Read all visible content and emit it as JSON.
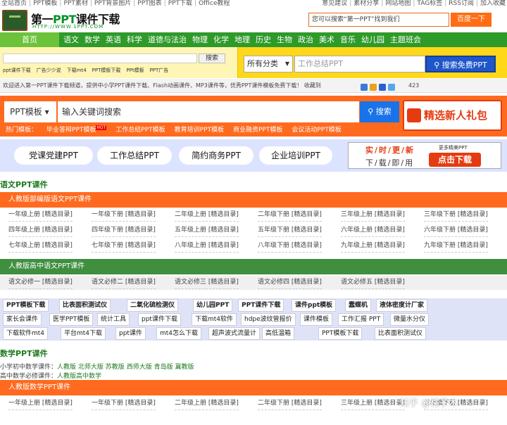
{
  "topnav": {
    "left": [
      "全站首页",
      "PPT模板",
      "PPT素材",
      "PPT背景图片",
      "PPT图表",
      "PPT下载",
      "Office教程"
    ],
    "right": [
      "意见建议",
      "素材分享",
      "网站地图",
      "TAG标签",
      "RSS订阅",
      "加入收藏"
    ]
  },
  "header": {
    "logo_title_prefix": "第一",
    "logo_title_ppt": "PPT",
    "logo_title_suffix": "课件下载",
    "logo_url": "HTTP://WWW.1PPT.COM",
    "search_value": "您可以搜索“第一PPT”找到我们",
    "search_button": "百度一下"
  },
  "mainnav": {
    "home": "首页",
    "items": [
      "语文",
      "数学",
      "英语",
      "科学",
      "道德与法治",
      "物理",
      "化学",
      "地理",
      "历史",
      "生物",
      "政治",
      "美术",
      "音乐",
      "幼儿园",
      "主题班会"
    ]
  },
  "subbar": {
    "search_button": "搜索",
    "links": [
      "ppt课件下载",
      "广告少少说",
      "下载mt4",
      "PPT模板下载",
      "PPt模板",
      "PPT广告"
    ],
    "select": "所有分类",
    "big_placeholder": "工作总结PPT",
    "big_button": "搜索免费PPT"
  },
  "welcome": {
    "text": "欢迎进入第一PPT课件下载频道，提供中小学PPT课件下载、Flash动画课件、MP3课件等，优秀PPT课件模板免费下载！ 收藏到",
    "count": "423"
  },
  "ppt_search": {
    "dropdown": "PPT模板",
    "input": "输入关键词搜索",
    "button": "搜索",
    "gift": "精选新人礼包",
    "hot_prefix": "热门模板：",
    "hot": [
      "毕业答辩PPT模板",
      "工作总结PPT模板",
      "教育培训PPT模板",
      "商业融资PPT模板",
      "会议活动PPT模板"
    ],
    "hot_badge": "HOT"
  },
  "pills": [
    "党课党建PPT",
    "工作总结PPT",
    "简约商务PPT",
    "企业培训PPT"
  ],
  "ad": {
    "line1": "实/时/更/新",
    "line2": "下/载/即/用",
    "small": "更多精美PPT",
    "button": "点击下载"
  },
  "chinese": {
    "title": "语文PPT课件",
    "band1": "人教版部编版语文PPT课件",
    "rows": [
      [
        "一年级上册 [精选目录]",
        "一年级下册 [精选目录]",
        "二年级上册 [精选目录]",
        "二年级下册 [精选目录]",
        "三年级上册 [精选目录]",
        "三年级下册 [精选目录]"
      ],
      [
        "四年级上册 [精选目录]",
        "四年级下册 [精选目录]",
        "五年级上册 [精选目录]",
        "五年级下册 [精选目录]",
        "六年级上册 [精选目录]",
        "六年级下册 [精选目录]"
      ],
      [
        "七年级上册 [精选目录]",
        "七年级下册 [精选目录]",
        "八年级上册 [精选目录]",
        "八年级下册 [精选目录]",
        "九年级上册 [精选目录]",
        "九年级下册 [精选目录]"
      ]
    ],
    "band2": "人教版高中语文PPT课件",
    "hs_row": [
      "语文必修一 [精选目录]",
      "语文必修二 [精选目录]",
      "语文必修三 [精选目录]",
      "语文必修四 [精选目录]",
      "语文必修五 [精选目录]"
    ]
  },
  "links": [
    [
      "PPT模板下载",
      "比表面积测试仪",
      "二氧化硫检测仪",
      "幼儿园PPT",
      "PPT课件下载",
      "课件ppt模板",
      "蠢蝶机",
      "液体密度计厂家"
    ],
    [
      "家长会课件",
      "医学PPT模板",
      "统计工具",
      "ppt课件下载",
      "下载mt4软件",
      "hdpe波纹管报价",
      "课件模板",
      "工作汇报 PPT",
      "微量水分仪"
    ],
    [
      "下载软件mt4",
      "平台mt4下载",
      "ppt课件",
      "mt4怎么下载",
      "超声波式流量计",
      "高低温箱",
      "PPT模板下载",
      "比表面积测试仪"
    ]
  ],
  "math": {
    "title": "数学PPT课件",
    "line1_label": "小学初中数学课件：",
    "line1": [
      "人教版",
      "北师大版",
      "苏教版",
      "西师大版",
      "青岛版",
      "冀教版"
    ],
    "line2_label": "高中数学必修课件：",
    "line2": [
      "人教版高中数学"
    ],
    "band": "人教版数学PPT课件",
    "row": [
      "一年级上册 [精选目录]",
      "一年级下册 [精选目录]",
      "二年级上册 [精选目录]",
      "二年级下册 [精选目录]",
      "三年级上册 [精选目录]",
      "三年级下册 [精选目录]"
    ]
  },
  "watermark": "知乎 @格子木",
  "colors": {
    "green": "#2e9a2a",
    "orange": "#ff6a1f",
    "blue": "#1f56c9",
    "yellow": "#ffd81a"
  }
}
